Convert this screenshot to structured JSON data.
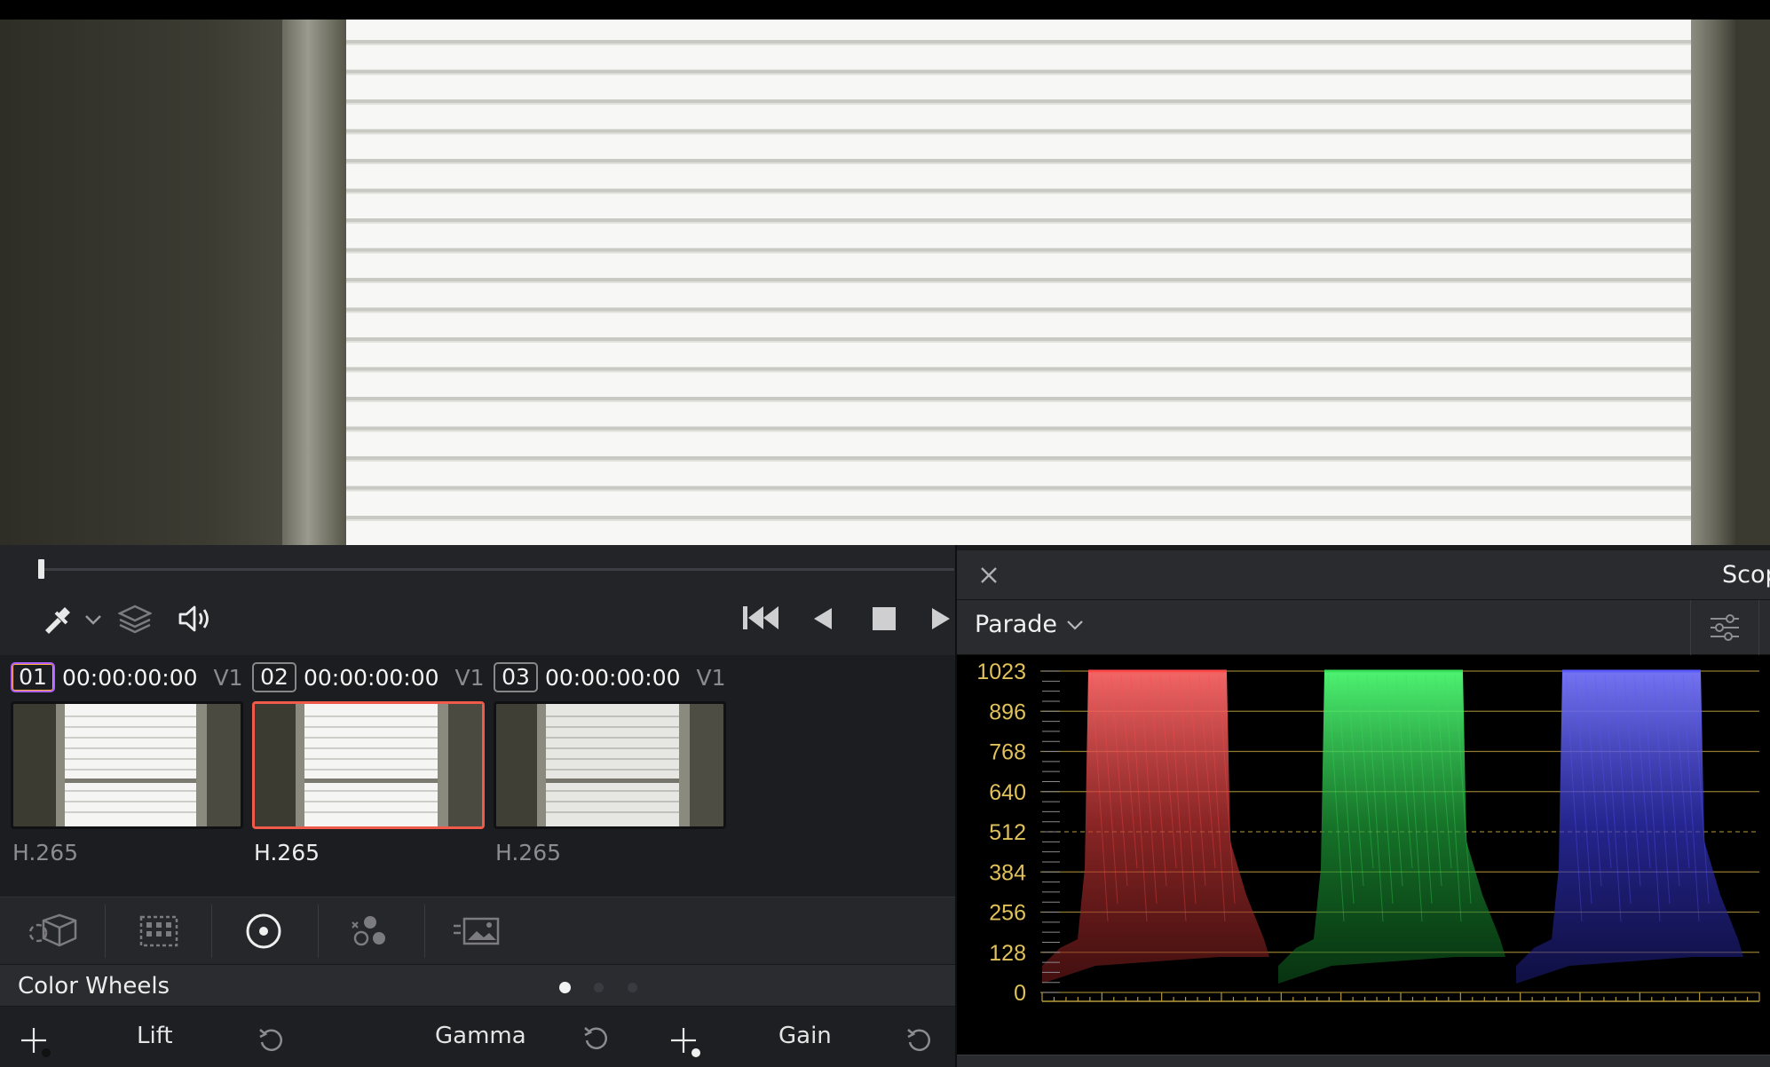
{
  "transport": {
    "scrubber_position": 0.0,
    "tools": [
      "picker-icon",
      "layers-icon",
      "audio-icon"
    ],
    "controls": [
      "skip-to-start-icon",
      "play-reverse-icon",
      "stop-icon",
      "play-forward-icon"
    ]
  },
  "clips": [
    {
      "number": "01",
      "timecode": "00:00:00:00",
      "track": "V1",
      "codec": "H.265",
      "selected": false,
      "current": true
    },
    {
      "number": "02",
      "timecode": "00:00:00:00",
      "track": "V1",
      "codec": "H.265",
      "selected": true,
      "current": false
    },
    {
      "number": "03",
      "timecode": "00:00:00:00",
      "track": "V1",
      "codec": "H.265",
      "selected": false,
      "current": false
    }
  ],
  "palette": {
    "icons": [
      "camera-raw-icon",
      "color-match-icon",
      "color-wheels-icon",
      "rgb-mixer-icon",
      "motion-effects-icon"
    ],
    "active": "color-wheels-icon"
  },
  "color_wheels": {
    "title": "Color Wheels",
    "page_count": 3,
    "active_page": 0,
    "labels": {
      "lift": "Lift",
      "gamma": "Gamma",
      "gain": "Gain"
    }
  },
  "scopes": {
    "title": "Scop",
    "type": "Parade",
    "axis_labels": [
      "1023",
      "896",
      "768",
      "640",
      "512",
      "384",
      "256",
      "128",
      "0"
    ],
    "colors": {
      "red": "#ff4a4a",
      "green": "#39e05a",
      "blue": "#5a5aff",
      "grid": "#b59b3c"
    }
  }
}
